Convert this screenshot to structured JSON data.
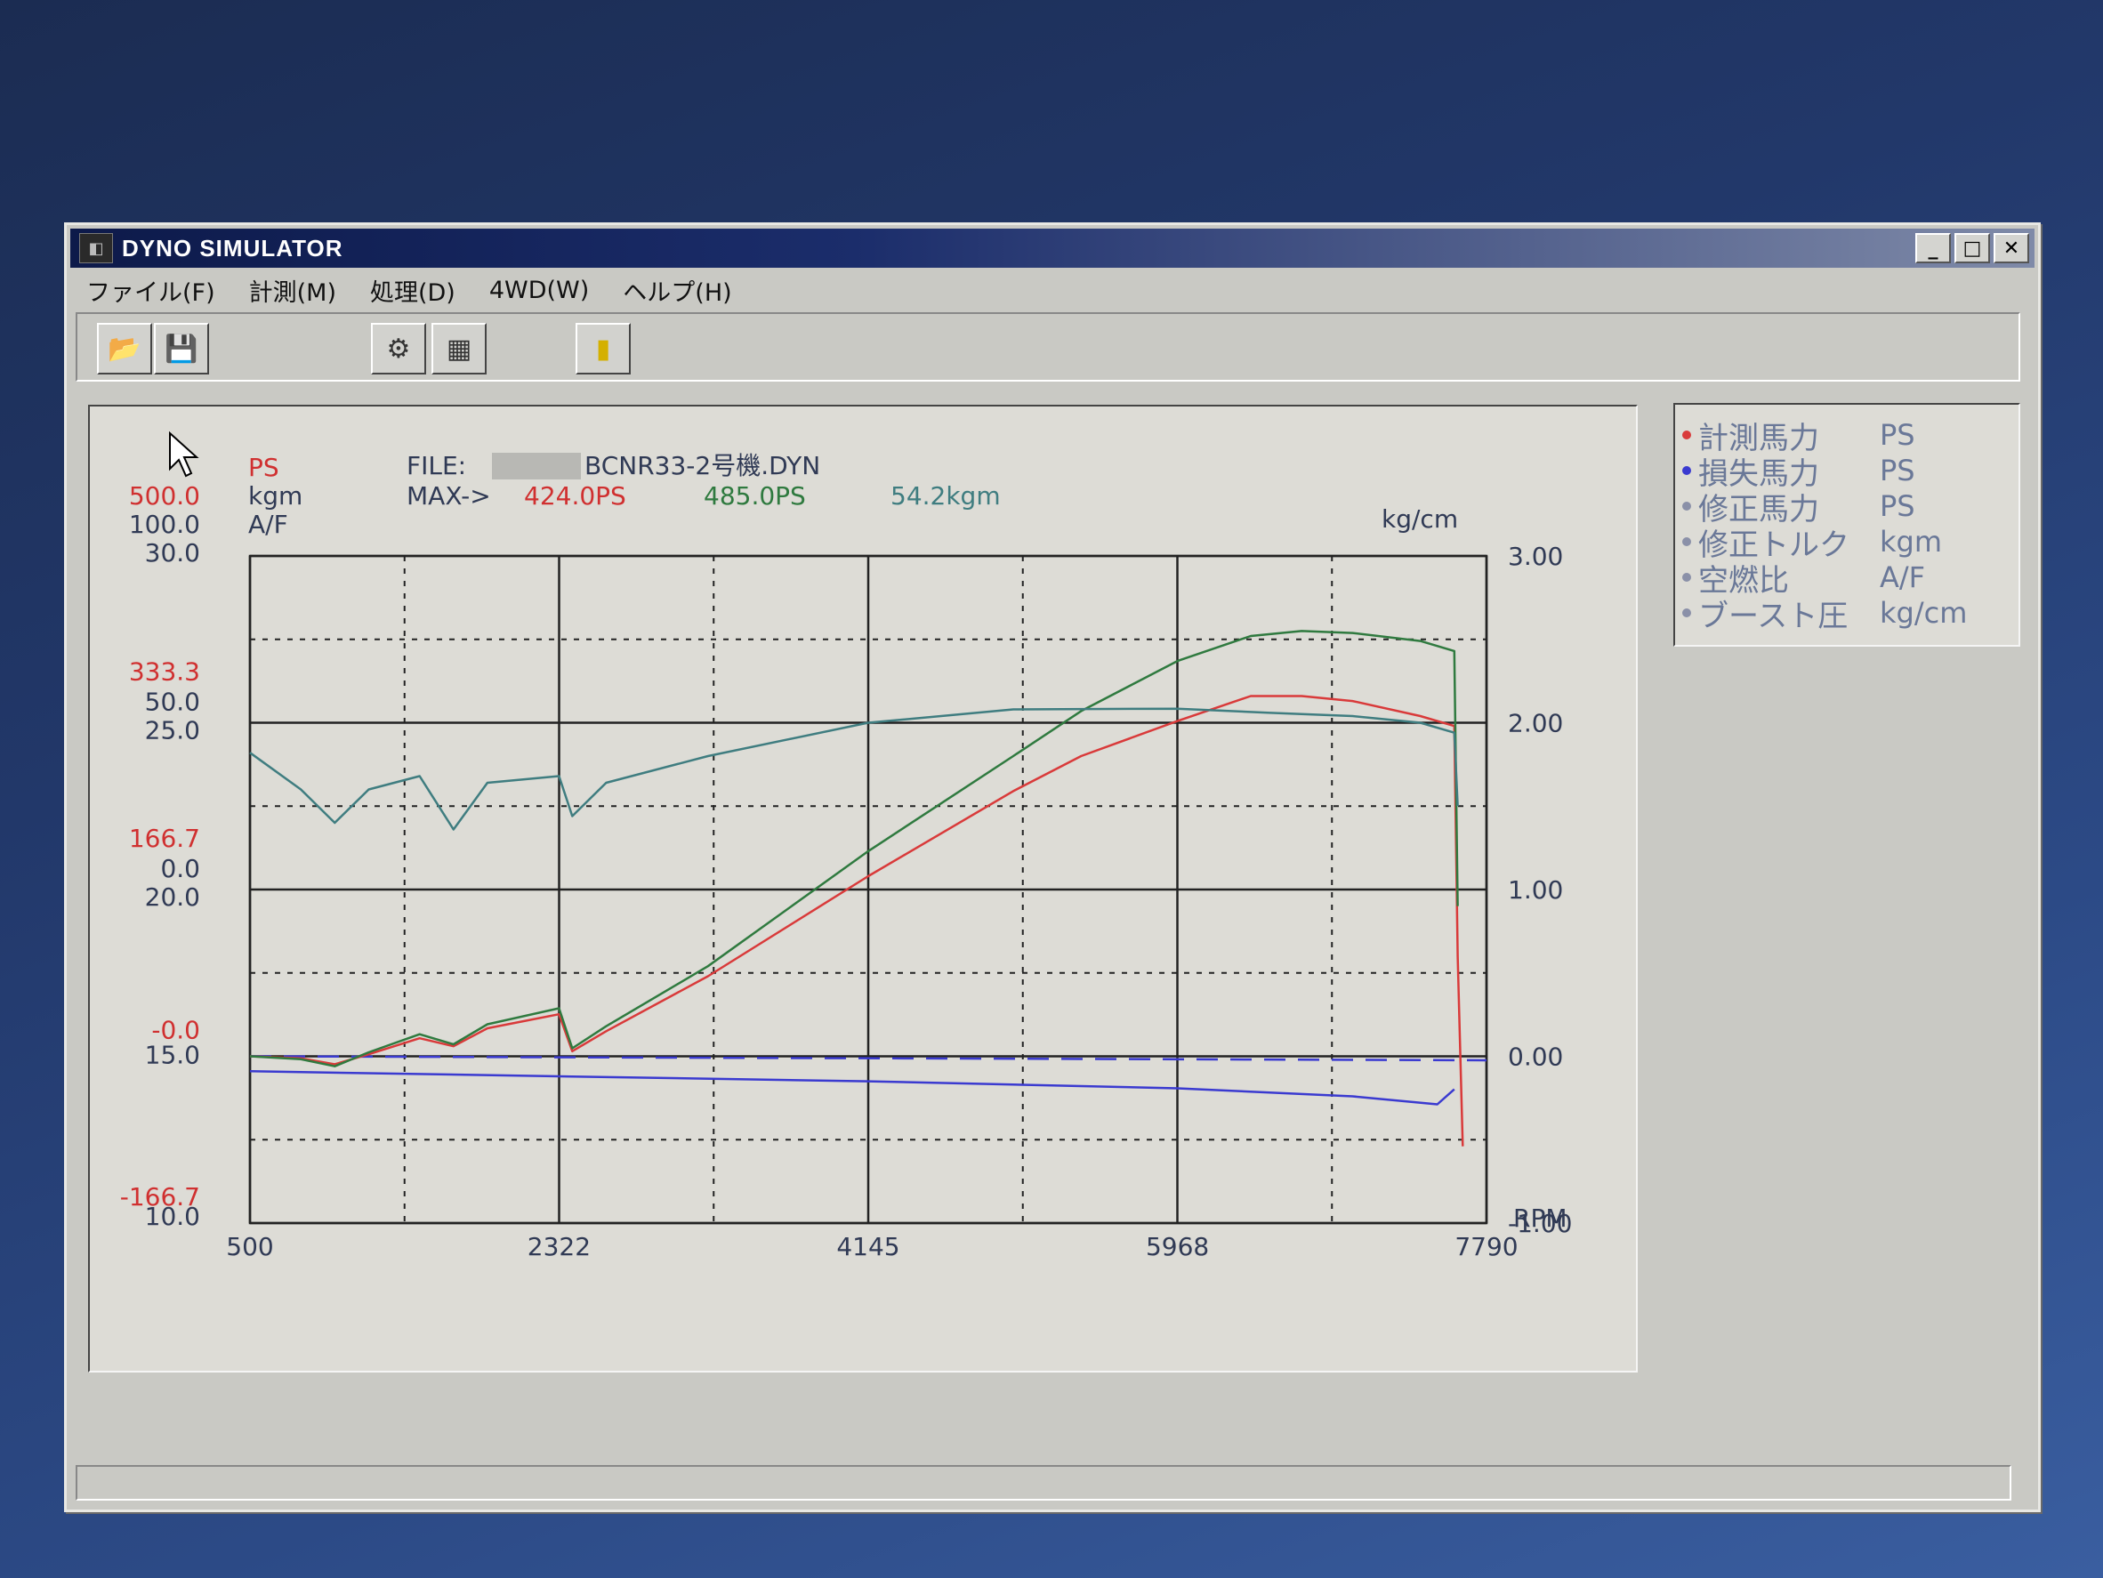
{
  "window": {
    "title": "DYNO SIMULATOR",
    "controls": [
      "_",
      "□",
      "✕"
    ]
  },
  "menu": [
    "ファイル(F)",
    "計測(M)",
    "処理(D)",
    "4WD(W)",
    "ヘルプ(H)"
  ],
  "toolbar": {
    "buttons": [
      {
        "name": "open-file-button",
        "icon": "folder-open-icon",
        "glyph": "📂"
      },
      {
        "name": "save-file-button",
        "icon": "floppy-disk-icon",
        "glyph": "💾"
      },
      {
        "name": "measure-button",
        "icon": "dyno-icon",
        "glyph": "⚙"
      },
      {
        "name": "display-button",
        "icon": "display-panel-icon",
        "glyph": "▦"
      },
      {
        "name": "exit-button",
        "icon": "exit-door-icon",
        "glyph": "▮"
      }
    ]
  },
  "graph": {
    "file_label": "FILE:",
    "file_name": "BCNR33-2号機.DYN",
    "max_label": "MAX->",
    "max_ps_red": "424.0PS",
    "max_ps_green": "485.0PS",
    "max_torque": "54.2kgm",
    "unit_ps": "PS",
    "unit_kgm": "kgm",
    "unit_af": "A/F",
    "unit_boost": "kg/cm",
    "unit_rpm": "RPM"
  },
  "colors": {
    "measured_ps": "#d93a3a",
    "loss_ps": "#3a3ad0",
    "corrected_ps": "#2f7a3f",
    "torque": "#3f7d80",
    "grid": "#222222",
    "axis_text_red": "#d03030",
    "axis_text_dark": "#303a55"
  },
  "legend": [
    {
      "name": "計測馬力",
      "unit": "PS",
      "color": "#d93a3a"
    },
    {
      "name": "損失馬力",
      "unit": "PS",
      "color": "#3a3ad0"
    },
    {
      "name": "修正馬力",
      "unit": "PS",
      "color": "#8a90a8"
    },
    {
      "name": "修正トルク",
      "unit": "kgm",
      "color": "#8a90a8"
    },
    {
      "name": "空燃比",
      "unit": "A/F",
      "color": "#8a90a8"
    },
    {
      "name": "ブースト圧",
      "unit": "kg/cm",
      "color": "#8a90a8"
    }
  ],
  "chart_data": {
    "type": "line",
    "x": [
      500,
      1500,
      2322,
      3200,
      4145,
      5000,
      5968,
      6800,
      7400,
      7600,
      7700
    ],
    "xticks": [
      500,
      2322,
      4145,
      5968,
      7790
    ],
    "x_range": [
      500,
      7790
    ],
    "left_ticks": {
      "ps": [
        "500.0",
        "333.3",
        "166.7",
        "-0.0",
        "-166.7"
      ],
      "kgm": [
        "100.0",
        "50.0",
        "0.0"
      ],
      "af": [
        "30.0",
        "25.0",
        "20.0",
        "15.0",
        "10.0"
      ]
    },
    "right_ticks": [
      "3.00",
      "2.00",
      "1.00",
      "0.00",
      "-1.00"
    ],
    "ps_range": [
      -166.7,
      500
    ],
    "series": [
      {
        "name": "計測馬力",
        "unit": "PS",
        "color": "#d93a3a",
        "x": [
          500,
          800,
          1000,
          1200,
          1500,
          1700,
          1900,
          2322,
          2400,
          2600,
          3200,
          4145,
          5000,
          5400,
          5968,
          6400,
          6700,
          7000,
          7400,
          7600,
          7620,
          7650
        ],
        "values": [
          0,
          -2,
          -8,
          2,
          18,
          10,
          28,
          42,
          5,
          25,
          80,
          180,
          265,
          300,
          335,
          360,
          360,
          355,
          340,
          330,
          100,
          -90
        ]
      },
      {
        "name": "修正馬力",
        "unit": "PS",
        "color": "#2f7a3f",
        "x": [
          500,
          800,
          1000,
          1200,
          1500,
          1700,
          1900,
          2322,
          2400,
          2600,
          3200,
          4145,
          5000,
          5400,
          5968,
          6400,
          6700,
          7000,
          7400,
          7600,
          7620
        ],
        "values": [
          0,
          -3,
          -10,
          4,
          22,
          12,
          32,
          48,
          8,
          30,
          90,
          205,
          300,
          345,
          395,
          420,
          425,
          423,
          415,
          405,
          150
        ]
      },
      {
        "name": "修正トルク",
        "unit": "kgm",
        "color": "#3f7d80",
        "x": [
          500,
          800,
          1000,
          1200,
          1500,
          1700,
          1900,
          2322,
          2400,
          2600,
          3200,
          4145,
          5000,
          5968,
          6500,
          7000,
          7400,
          7600,
          7620
        ],
        "values": [
          41,
          30,
          20,
          30,
          34,
          18,
          32,
          34,
          22,
          32,
          40,
          50,
          54,
          54.2,
          53,
          52,
          50,
          47,
          25
        ]
      },
      {
        "name": "損失馬力",
        "unit": "PS",
        "color": "#3a3ad0",
        "x": [
          500,
          2322,
          4145,
          5968,
          7000,
          7500,
          7600
        ],
        "values": [
          -15,
          -20,
          -25,
          -32,
          -40,
          -48,
          -33
        ]
      }
    ]
  }
}
